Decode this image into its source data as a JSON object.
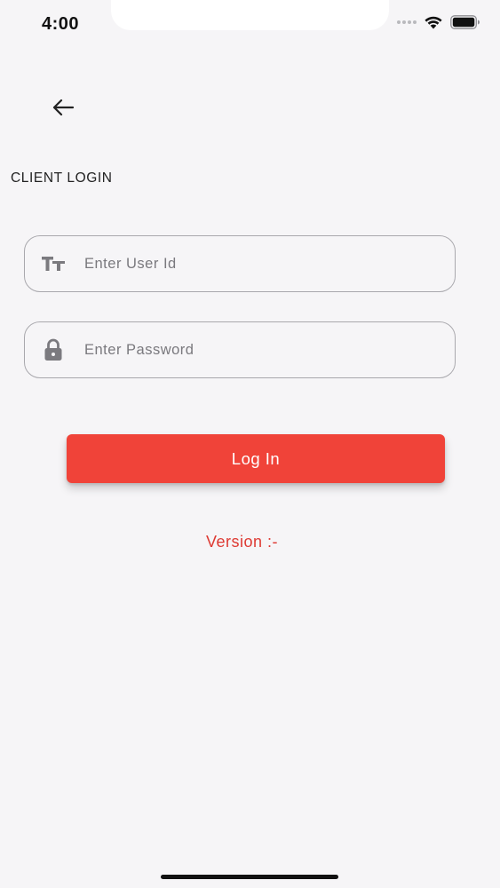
{
  "status_bar": {
    "time": "4:00",
    "icons": [
      "signal-dots-icon",
      "wifi-icon",
      "battery-icon"
    ]
  },
  "header": {
    "back_icon": "arrow-left-icon",
    "title": "CLIENT LOGIN"
  },
  "form": {
    "user_id": {
      "icon": "text-size-icon",
      "value": "",
      "placeholder": "Enter User Id"
    },
    "password": {
      "icon": "lock-icon",
      "value": "",
      "placeholder": "Enter Password"
    },
    "login_label": "Log In"
  },
  "footer": {
    "version_label": "Version :-"
  },
  "colors": {
    "accent": "#f04339",
    "version_text": "#de3a33",
    "background": "#f6f5f7"
  }
}
